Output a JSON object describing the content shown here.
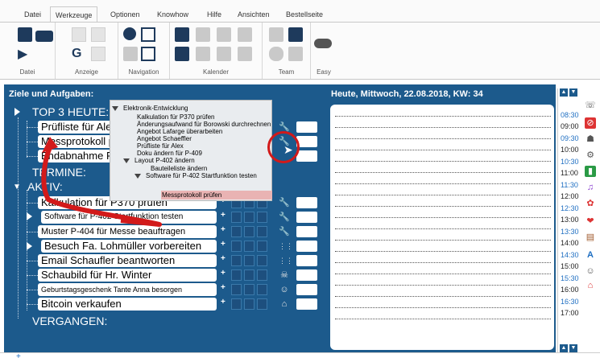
{
  "tabs": [
    {
      "label": "Datei",
      "active": false
    },
    {
      "label": "Werkzeuge",
      "active": true
    },
    {
      "label": "Optionen",
      "active": false
    },
    {
      "label": "Knowhow",
      "active": false
    },
    {
      "label": "Hilfe",
      "active": false
    },
    {
      "label": "Ansichten",
      "active": false
    },
    {
      "label": "Bestellseite",
      "active": false
    }
  ],
  "groups": [
    "Datei",
    "Anzeige",
    "Navigation",
    "Kalender",
    "Team",
    "Easy"
  ],
  "board": {
    "left_title": "Ziele und Aufgaben:",
    "right_title": "Heute, Mittwoch, 22.08.2018, KW: 34"
  },
  "sections": {
    "top3": "TOP 3 HEUTE:",
    "termine": "TERMINE:",
    "aktiv": "AKTIV:",
    "vergangen": "VERGANGEN:"
  },
  "top3_tasks": [
    {
      "label": "Prüfliste für Alex"
    },
    {
      "label": "Messprotokoll prüfen"
    },
    {
      "label": "Endabnahme Flughafen"
    }
  ],
  "active_tasks": [
    {
      "label": "Kalkulation für P370 prüfen",
      "size": "big"
    },
    {
      "label": "Software für P-402 Startfunktion testen",
      "size": "mid"
    },
    {
      "label": "Muster P-404 für Messe beauftragen",
      "size": "mid"
    },
    {
      "label": "Besuch Fa. Lohmüller vorbereiten",
      "size": "big"
    },
    {
      "label": "Email Schaufler beantworten",
      "size": "big"
    },
    {
      "label": "Schaubild für Hr. Winter",
      "size": "big"
    },
    {
      "label": "Geburtstagsgeschenk Tante Anna besorgen",
      "size": "small"
    },
    {
      "label": "Bitcoin verkaufen",
      "size": "big"
    }
  ],
  "popup": {
    "root": "Elektronik-Entwicklung",
    "items": [
      "Kalkulation für P370 prüfen",
      "Änderungsaufwand für Borowski durchrechnen",
      "Angebot Lafarge überarbeiten",
      "Angebot Schaeffler",
      "Prüfliste für Alex",
      "Doku ändern für P-409"
    ],
    "sub1": "Layout P-402 ändern",
    "sub1_item": "Bauteileliste ändern",
    "sub2": "Software für P-402 Startfunktion testen",
    "sub2_item": "Messprotokoll prüfen"
  },
  "times": [
    "08:30",
    "09:00",
    "09:30",
    "10:00",
    "10:30",
    "11:00",
    "11:30",
    "12:00",
    "12:30",
    "13:00",
    "13:30",
    "14:00",
    "14:30",
    "15:00",
    "15:30",
    "16:00",
    "16:30",
    "17:00"
  ],
  "plus_char": "+",
  "colors": {
    "board": "#1c5a8c",
    "annotation": "#d21a1a",
    "time_half": "#1f6fc2"
  }
}
